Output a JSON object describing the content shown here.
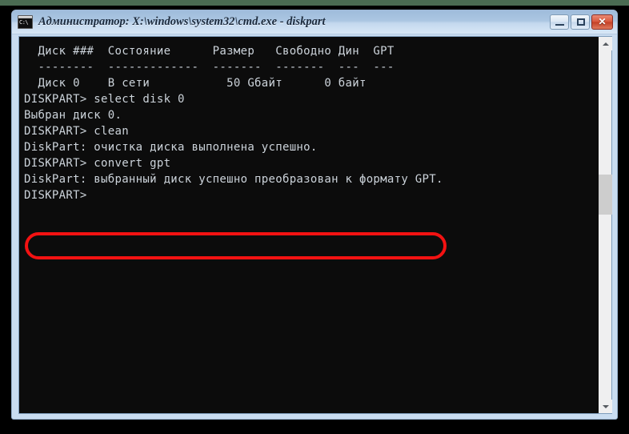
{
  "window": {
    "title": "Администратор: X:\\windows\\system32\\cmd.exe - diskpart",
    "icon_name": "cmd-console-icon",
    "icon_glyph": "C:\\",
    "buttons": {
      "minimize_label": "",
      "maximize_label": "",
      "close_label": "✕"
    }
  },
  "console": {
    "lines": [
      "  Диск ###  Состояние      Размер   Свободно Дин  GPT",
      "  --------  -------------  -------  -------  ---  ---",
      "  Диск 0    В сети           50 Gбайт      0 байт",
      "",
      "DISKPART> select disk 0",
      "",
      "Выбран диск 0.",
      "",
      "DISKPART> clean",
      "",
      "DiskPart: очистка диска выполнена успешно.",
      "",
      "DISKPART> convert gpt",
      "",
      "DiskPart: выбранный диск успешно преобразован к формату GPT.",
      "",
      "DISKPART>"
    ]
  },
  "scrollbar": {
    "up_arrow": "▲",
    "down_arrow": "▼"
  },
  "annotation": {
    "color": "#f31212",
    "highlighted_text": "DiskPart: выбранный диск успешно преобразован к формату GPT."
  }
}
